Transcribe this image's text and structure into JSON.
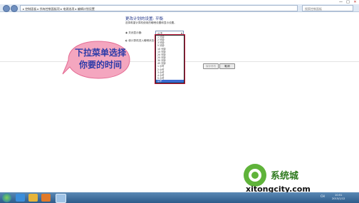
{
  "explorer": {
    "breadcrumb": "▸ 控制面板 ▸ 所有控制面板项 ▸ 电源选项 ▸ 编辑计划设置",
    "search_placeholder": "搜索控制面板",
    "minimize": "—",
    "maximize": "□",
    "close": "✕"
  },
  "page": {
    "title": "更改计划的设置: 平衡",
    "subtitle": "选择希望计算机使用的睡眠设置和显示设置。",
    "display_label": "关闭显示器:",
    "display_value": "从不",
    "sleep_label": "使计算机进入睡眠状态:"
  },
  "dropdown": {
    "options": [
      "1 分钟",
      "2 分钟",
      "3 分钟",
      "5 分钟",
      "10 分钟",
      "15 分钟",
      "20 分钟",
      "25 分钟",
      "30 分钟",
      "45 分钟",
      "1 小时",
      "2 小时",
      "3 小时",
      "4 小时",
      "5 小时",
      "从不"
    ],
    "selected_index": 15
  },
  "buttons": {
    "save": "保存修改",
    "cancel": "取消"
  },
  "annotation": {
    "line1": "下拉菜单选择",
    "line2": "你要的时间"
  },
  "watermark": {
    "brand": "系统城",
    "url": "xitongcity.com"
  },
  "taskbar": {
    "tray_lang": "CH",
    "time": "10:51",
    "date": "2015/1/12"
  },
  "colors": {
    "title_blue": "#1e3287",
    "bubble_fill": "#f4a6bf",
    "bubble_text": "#2a3aa8",
    "highlight_red": "#c2183c",
    "selected_option": "#3a6ad0",
    "taskbar": "#2e5b8a"
  }
}
